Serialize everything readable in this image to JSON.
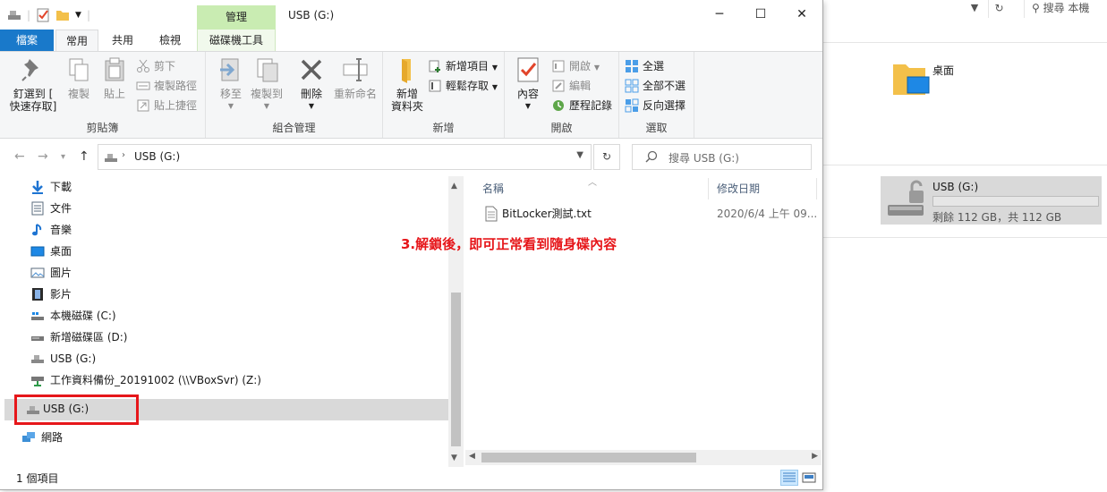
{
  "window": {
    "title": "USB (G:)",
    "context_tab_label": "管理",
    "minimize_label": "─",
    "maximize_label": "☐",
    "close_label": "✕"
  },
  "tabs": [
    {
      "label": "檔案"
    },
    {
      "label": "常用"
    },
    {
      "label": "共用"
    },
    {
      "label": "檢視"
    },
    {
      "label": "磁碟機工具"
    }
  ],
  "ribbon": {
    "clipboard": {
      "group_label": "剪貼簿",
      "pin_line1": "釘選到 [",
      "pin_line2": "快速存取]",
      "copy": "複製",
      "paste": "貼上",
      "cut": "剪下",
      "copy_path": "複製路徑",
      "paste_shortcut": "貼上捷徑"
    },
    "organize": {
      "group_label": "組合管理",
      "move_to": "移至",
      "copy_to": "複製到",
      "delete": "刪除",
      "rename": "重新命名"
    },
    "new": {
      "group_label": "新增",
      "new_folder_line1": "新增",
      "new_folder_line2": "資料夾",
      "new_item": "新增項目",
      "easy_access": "輕鬆存取"
    },
    "open": {
      "group_label": "開啟",
      "properties": "內容",
      "open": "開啟",
      "edit": "編輯",
      "history": "歷程記錄"
    },
    "select": {
      "group_label": "選取",
      "select_all": "全選",
      "select_none": "全部不選",
      "invert": "反向選擇"
    }
  },
  "nav": {
    "address": "USB (G:)",
    "search_placeholder": "搜尋 USB (G:)"
  },
  "sidebar": {
    "items": [
      {
        "label": "下載",
        "icon": "download-icon"
      },
      {
        "label": "文件",
        "icon": "document-icon"
      },
      {
        "label": "音樂",
        "icon": "music-icon"
      },
      {
        "label": "桌面",
        "icon": "desktop-icon"
      },
      {
        "label": "圖片",
        "icon": "pictures-icon"
      },
      {
        "label": "影片",
        "icon": "videos-icon"
      },
      {
        "label": "本機磁碟 (C:)",
        "icon": "drive-icon"
      },
      {
        "label": "新增磁碟區 (D:)",
        "icon": "drive-icon"
      },
      {
        "label": "USB (G:)",
        "icon": "usb-drive-icon"
      },
      {
        "label": "工作資料備份_20191002 (\\\\VBoxSvr) (Z:)",
        "icon": "network-drive-icon"
      }
    ],
    "selected_item": {
      "label": "USB (G:)",
      "icon": "usb-drive-icon"
    },
    "network": {
      "label": "網路",
      "icon": "network-icon"
    }
  },
  "files": {
    "columns": [
      "名稱",
      "修改日期"
    ],
    "rows": [
      {
        "name": "BitLocker測試.txt",
        "modified": "2020/6/4 上午 09..."
      }
    ]
  },
  "annotation": "3.解鎖後，即可正常看到隨身碟內容",
  "status": {
    "item_count": "1 個項目"
  },
  "background_window": {
    "search_text": "搜尋 本機",
    "desktop_label": "桌面",
    "drive_name": "USB (G:)",
    "drive_free": "剩餘 112 GB，共 112 GB"
  },
  "colors": {
    "file_tab": "#1979ca",
    "context_tab": "#c9ecb2",
    "annotation_red": "#e6161a"
  }
}
